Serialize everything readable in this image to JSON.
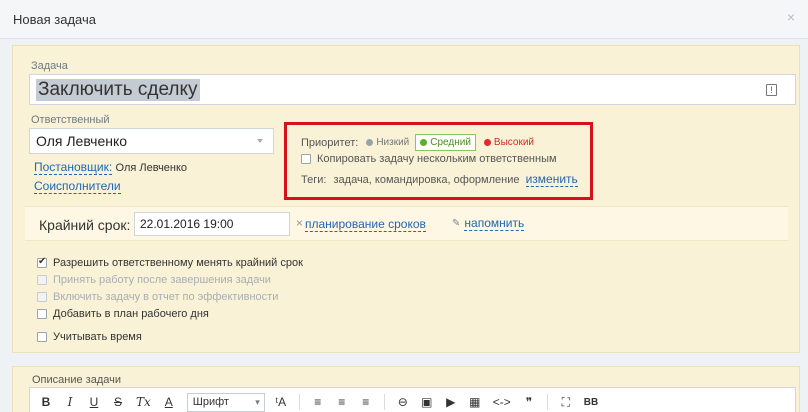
{
  "window": {
    "title": "Новая задача",
    "close": "×"
  },
  "task": {
    "label": "Задача",
    "value": "Заключить сделку",
    "icon": "template-icon"
  },
  "responsible": {
    "label": "Ответственный",
    "value": "Оля Левченко"
  },
  "creator": {
    "link": "Постановщик:",
    "name": "Оля Левченко"
  },
  "coexecutors": {
    "link": "Соисполнители"
  },
  "priority": {
    "label": "Приоритет:",
    "options": [
      "Низкий",
      "Средний",
      "Высокий"
    ],
    "selected": "Средний",
    "colors": {
      "low": "#9aa3aa",
      "medium": "#5aae2e",
      "high": "#e02b2b"
    }
  },
  "copy_task": {
    "label": "Копировать задачу нескольким ответственным"
  },
  "tags": {
    "label": "Теги:",
    "value": "задача, командировка, оформление",
    "change": "изменить"
  },
  "deadline": {
    "label": "Крайний срок:",
    "value": "22.01.2016 19:00",
    "clear": "×",
    "planning": "планирование сроков",
    "remind": "напомнить"
  },
  "options": [
    {
      "label": "Разрешить ответственному менять крайний срок",
      "checked": true,
      "disabled": false
    },
    {
      "label": "Принять работу после завершения задачи",
      "checked": false,
      "disabled": true
    },
    {
      "label": "Включить задачу в отчет по эффективности",
      "checked": false,
      "disabled": true
    },
    {
      "label": "Добавить в план рабочего дня",
      "checked": false,
      "disabled": false
    },
    {
      "label": "Учитывать время",
      "checked": false,
      "disabled": false
    }
  ],
  "description": {
    "label": "Описание задачи",
    "toolbar": {
      "bold": "B",
      "italic": "I",
      "underline": "U",
      "strike": "S",
      "clear_format": "Tx",
      "color": "A",
      "font": "Шрифт",
      "size": "ᵗA",
      "ordered": "≡",
      "unordered": "≡",
      "align": "≡",
      "link": "⊖",
      "image": "▣",
      "video": "▶",
      "table": "▦",
      "code": "<->",
      "quote": "❞",
      "fullscreen": "⛶",
      "bbcode": "BB"
    }
  },
  "colors": {
    "accent": "#2067b0",
    "panel": "#f9f2d7",
    "highlight_border": "#d6111b"
  }
}
